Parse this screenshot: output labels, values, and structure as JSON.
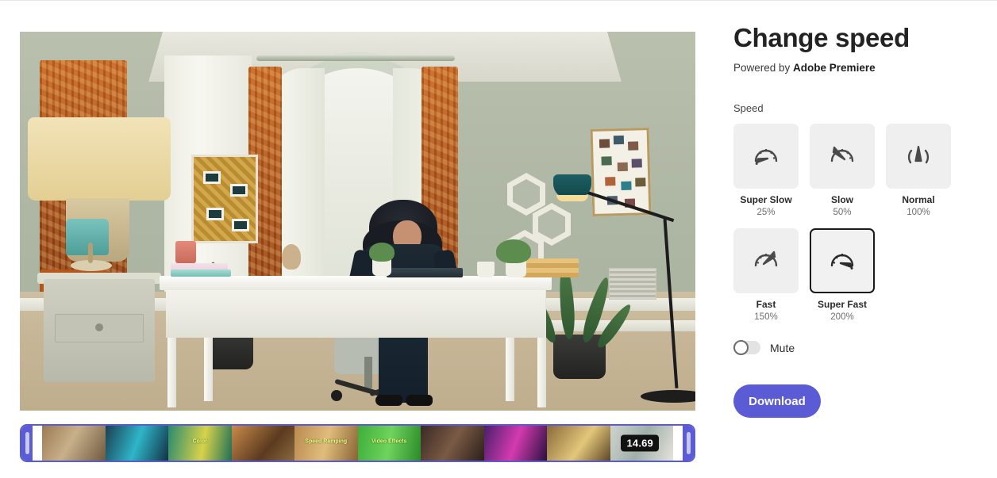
{
  "panel": {
    "title": "Change speed",
    "powered_prefix": "Powered by ",
    "powered_brand": "Adobe Premiere",
    "section_label": "Speed",
    "mute_label": "Mute",
    "download_label": "Download",
    "accent_color": "#5b5bd6",
    "tile_bg": "#efefef",
    "selected_border": "#1a1a1a"
  },
  "speed_options": [
    {
      "name": "Super Slow",
      "percent": "25%",
      "icon": "gauge-slow-icon",
      "selected": false
    },
    {
      "name": "Slow",
      "percent": "50%",
      "icon": "gauge-slower-icon",
      "selected": false
    },
    {
      "name": "Normal",
      "percent": "100%",
      "icon": "gauge-normal-icon",
      "selected": false
    },
    {
      "name": "Fast",
      "percent": "150%",
      "icon": "gauge-fast-icon",
      "selected": false
    },
    {
      "name": "Super Fast",
      "percent": "200%",
      "icon": "gauge-super-fast-icon",
      "selected": true
    }
  ],
  "toggle": {
    "mute_on": false
  },
  "timeline": {
    "duration_badge": "14.69",
    "handle_color": "#5b5bd6",
    "thumbnails": [
      {
        "overlay": ""
      },
      {
        "overlay": ""
      },
      {
        "overlay": "Color"
      },
      {
        "overlay": ""
      },
      {
        "overlay": "Speed Ramping"
      },
      {
        "overlay": "Video Effects"
      },
      {
        "overlay": ""
      },
      {
        "overlay": ""
      },
      {
        "overlay": ""
      },
      {
        "overlay": ""
      }
    ]
  },
  "preview": {
    "description": "Woman standing at a white desk in a home office with arched window, orange drapes, plants and a floor lamp"
  }
}
